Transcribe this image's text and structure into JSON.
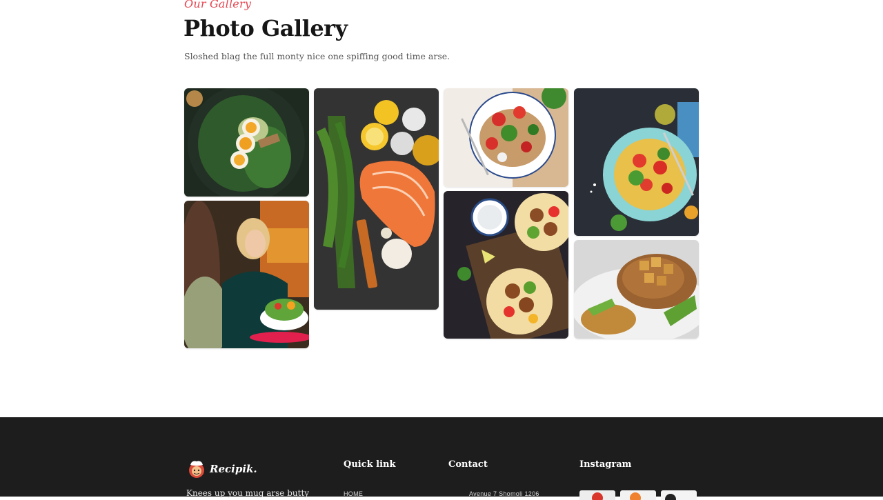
{
  "gallery": {
    "eyebrow": "Our Gallery",
    "title": "Photo Gallery",
    "subtitle": "Sloshed blag the full monty nice one spiffing good time arse.",
    "photos": [
      {
        "name": "egg-avocado-salad-photo"
      },
      {
        "name": "friends-dining-photo"
      },
      {
        "name": "salmon-steak-photo"
      },
      {
        "name": "vegetable-salad-plate-photo"
      },
      {
        "name": "falafel-wraps-photo"
      },
      {
        "name": "pasta-salad-photo"
      },
      {
        "name": "grilled-pork-chop-photo"
      }
    ]
  },
  "footer": {
    "logo_text": "Recipik.",
    "description": "Knees up you mug arse butty",
    "quick_link": {
      "heading": "Quick link",
      "items": [
        "HOME"
      ]
    },
    "contact": {
      "heading": "Contact",
      "address": "Avenue 7 Shomoli 1206"
    },
    "instagram": {
      "heading": "Instagram"
    }
  },
  "colors": {
    "accent": "#e8434f",
    "footer_bg": "#1d1d1d",
    "title": "#161616"
  }
}
